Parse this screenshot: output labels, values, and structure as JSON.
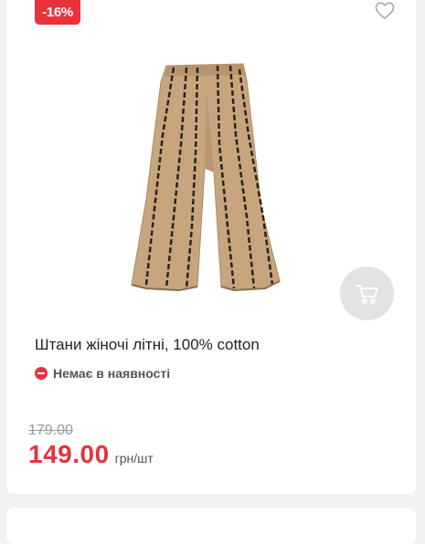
{
  "badge": {
    "discount": "-16%"
  },
  "product": {
    "title": "Штани жіночі літні, 100% cotton",
    "stock_status": "Немає в наявності",
    "old_price": "179.00",
    "new_price": "149.00",
    "unit": "грн/шт"
  },
  "icons": {
    "favorite": "heart-outline-icon",
    "cart": "shopping-cart-icon",
    "stock": "minus-circle-icon"
  },
  "colors": {
    "accent": "#e8323c",
    "fabric": "#c8a57d",
    "stripe": "#2a221c"
  }
}
